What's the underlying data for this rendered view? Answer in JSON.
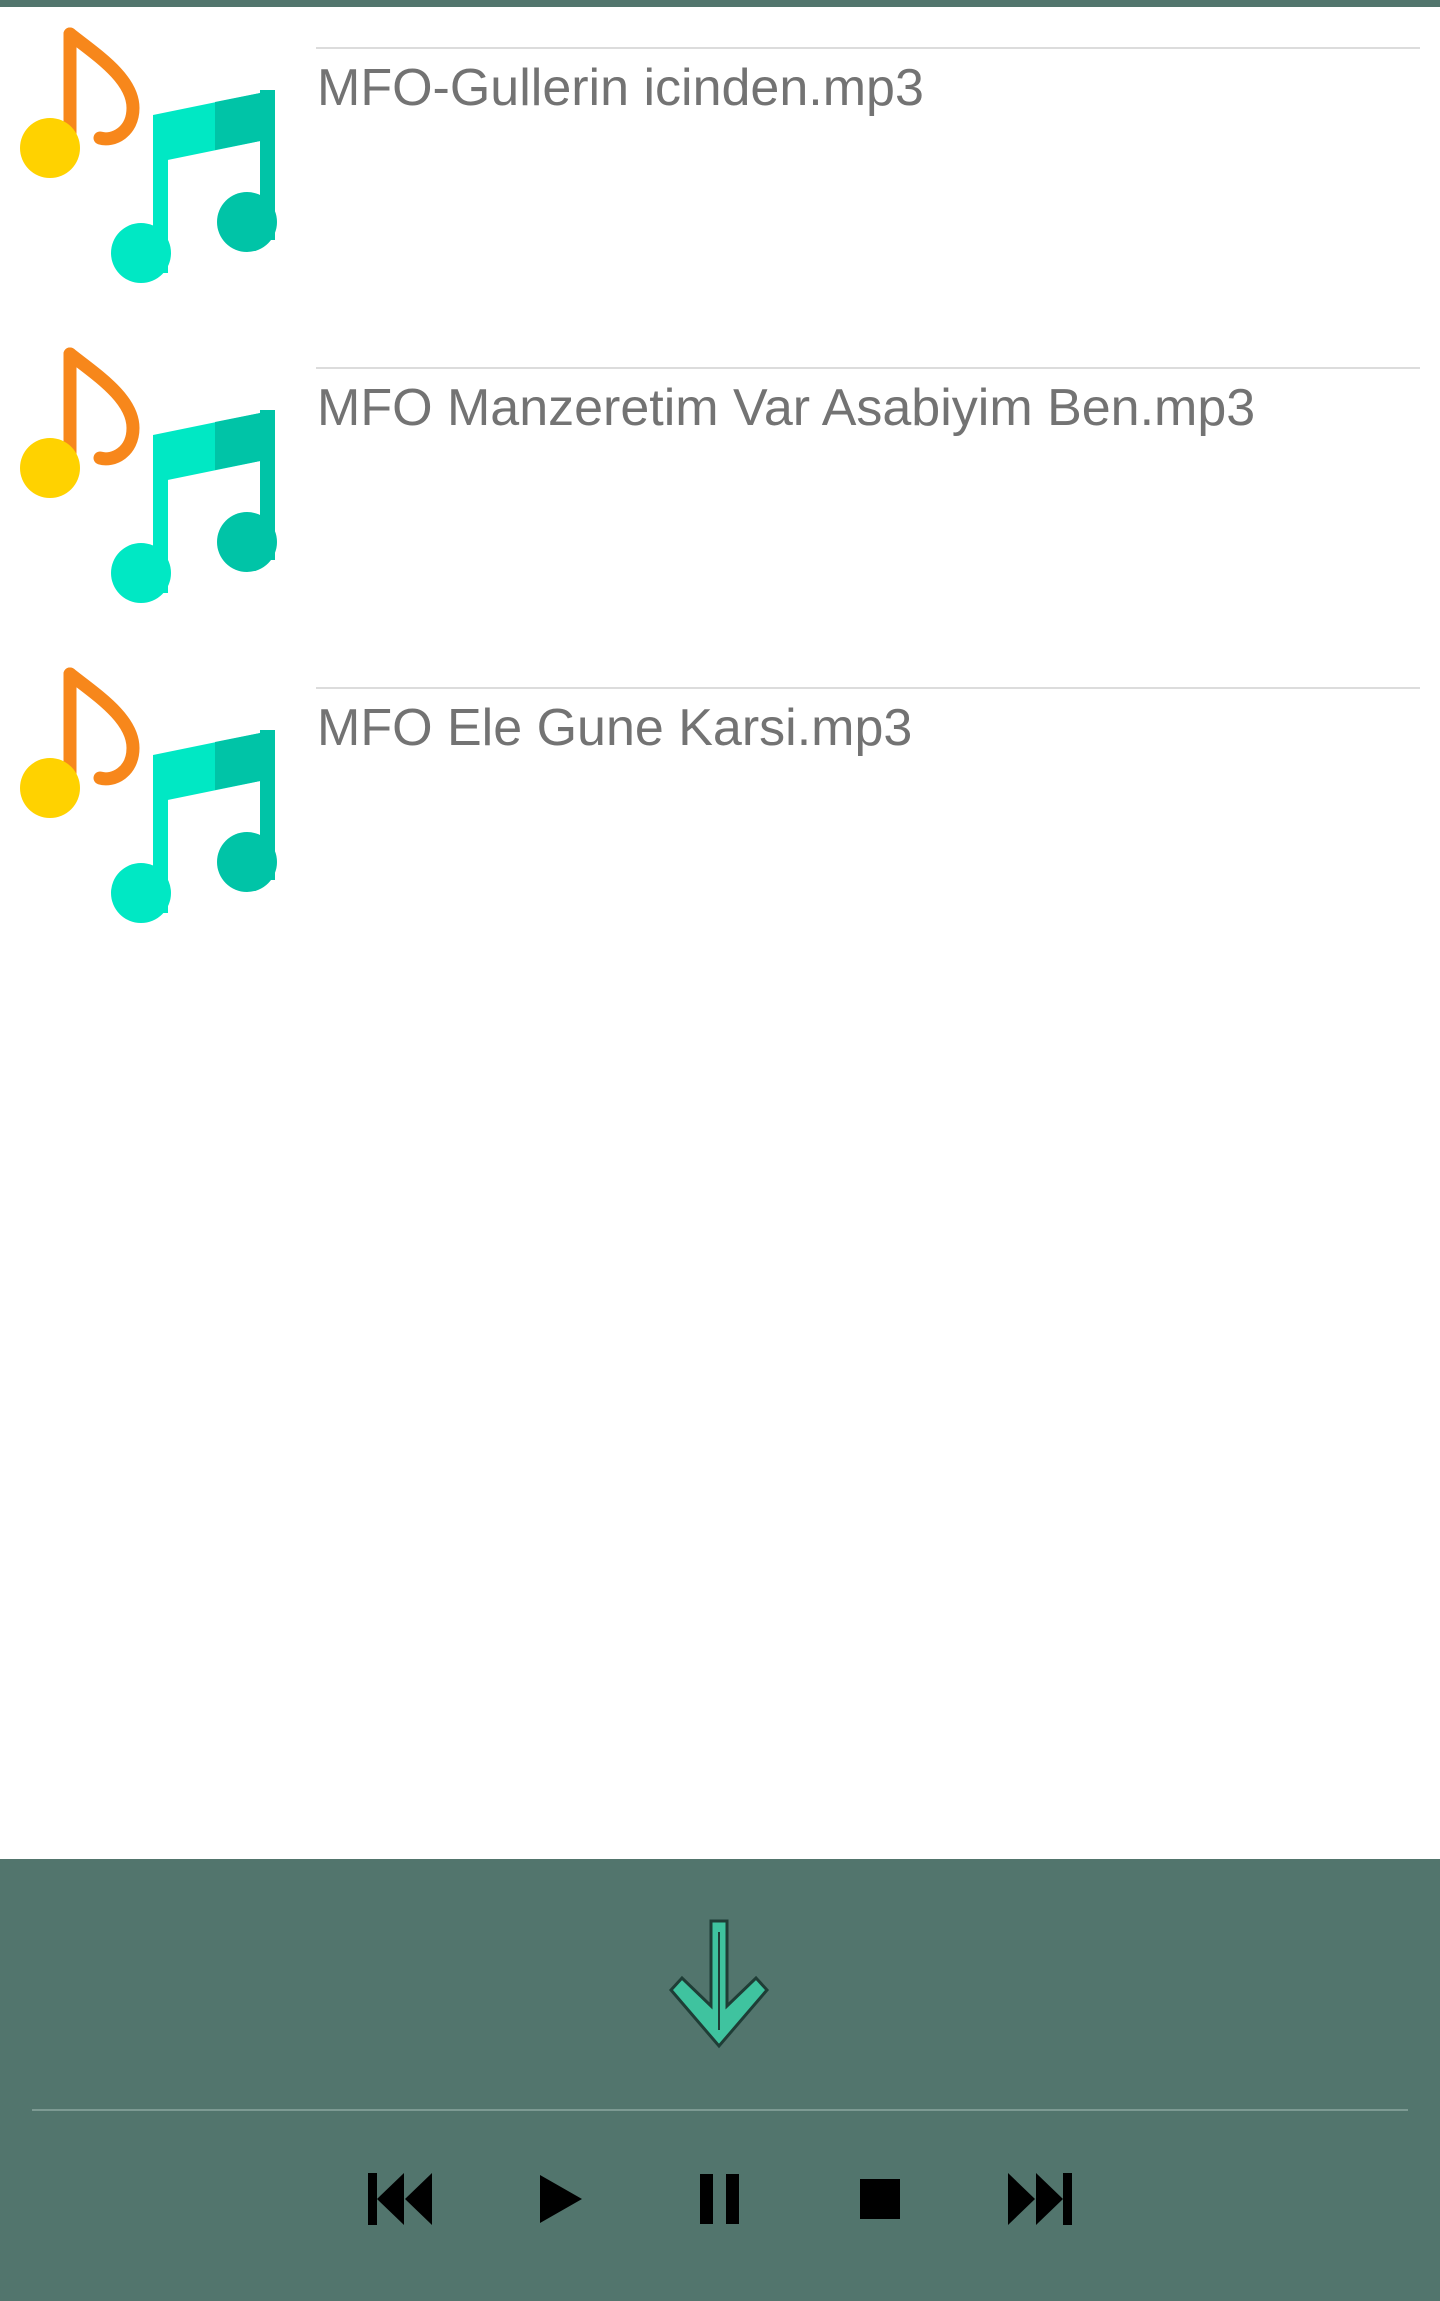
{
  "colors": {
    "panel_background": "#52756d",
    "title_text": "#737373",
    "icon_orange": "#f7871b",
    "icon_yellow": "#ffd200",
    "icon_teal": "#00e8c4",
    "icon_teal_dark": "#00c4a7",
    "arrow_fill": "#3fc39f"
  },
  "playlist": {
    "tracks": [
      {
        "title": "MFO-Gullerin icinden.mp3",
        "icon": "music-notes-icon"
      },
      {
        "title": "MFO Manzeretim Var Asabiyim Ben.mp3",
        "icon": "music-notes-icon"
      },
      {
        "title": "MFO Ele Gune Karsi.mp3",
        "icon": "music-notes-icon"
      }
    ]
  },
  "player": {
    "collapse_icon": "arrow-down-icon",
    "controls": [
      {
        "name": "previous",
        "icon": "skip-previous-icon"
      },
      {
        "name": "play",
        "icon": "play-icon"
      },
      {
        "name": "pause",
        "icon": "pause-icon"
      },
      {
        "name": "stop",
        "icon": "stop-icon"
      },
      {
        "name": "next",
        "icon": "skip-next-icon"
      }
    ]
  }
}
